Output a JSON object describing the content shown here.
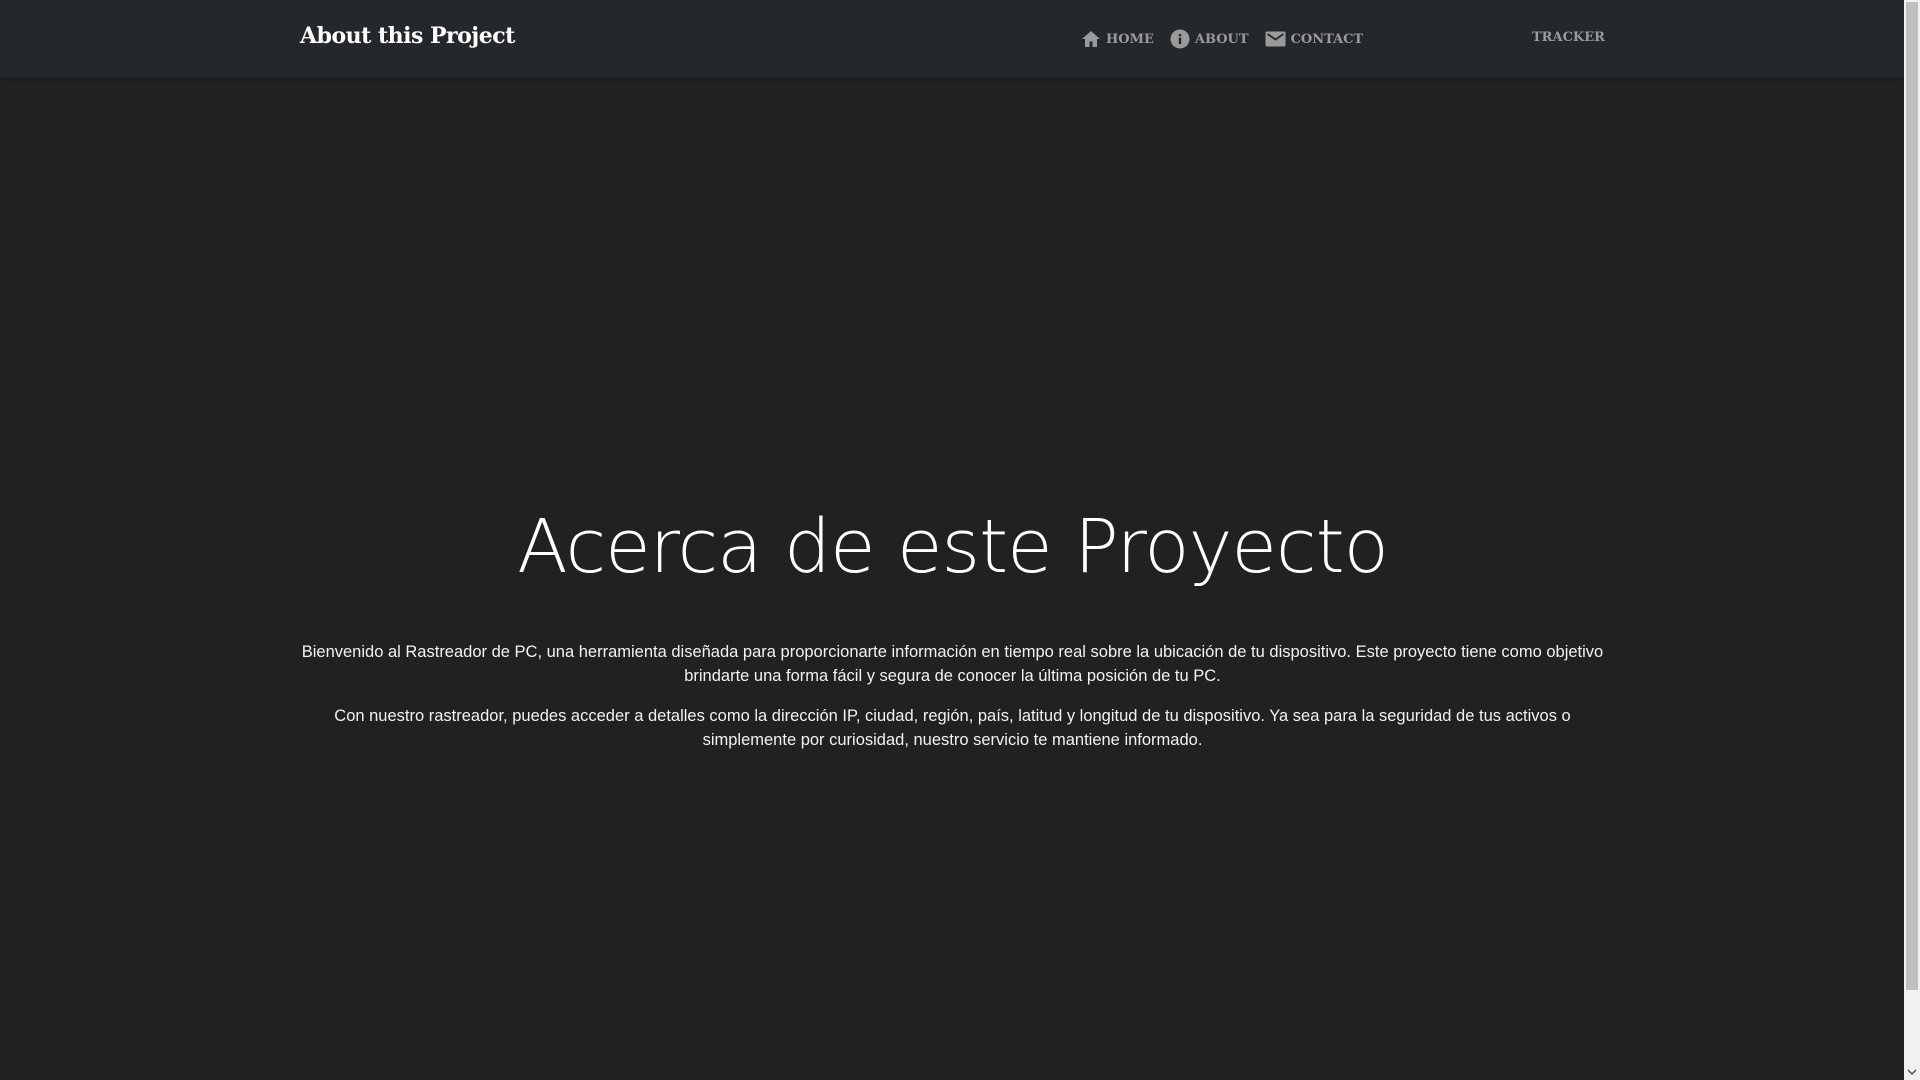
{
  "navbar": {
    "brand": "About this Project",
    "links": [
      {
        "label": "HOME",
        "icon": "home-icon"
      },
      {
        "label": "ABOUT",
        "icon": "info-icon"
      },
      {
        "label": "CONTACT",
        "icon": "mail-icon"
      }
    ],
    "tracker_label": "TRACKER"
  },
  "hero": {
    "title": "Acerca de este Proyecto",
    "paragraphs": [
      "Bienvenido al Rastreador de PC, una herramienta diseñada para proporcionarte información en tiempo real sobre la ubicación de tu dispositivo. Este proyecto tiene como objetivo brindarte una forma fácil y segura de conocer la última posición de tu PC.",
      "Con nuestro rastreador, puedes acceder a detalles como la dirección IP, ciudad, región, país, latitud y longitud de tu dispositivo. Ya sea para la seguridad de tus activos o simplemente por curiosidad, nuestro servicio te mantiene informado."
    ]
  },
  "colors": {
    "page_background": "#212121",
    "navbar_background": "#24272b",
    "nav_link": "#9a9a9a",
    "text": "#ffffff"
  }
}
